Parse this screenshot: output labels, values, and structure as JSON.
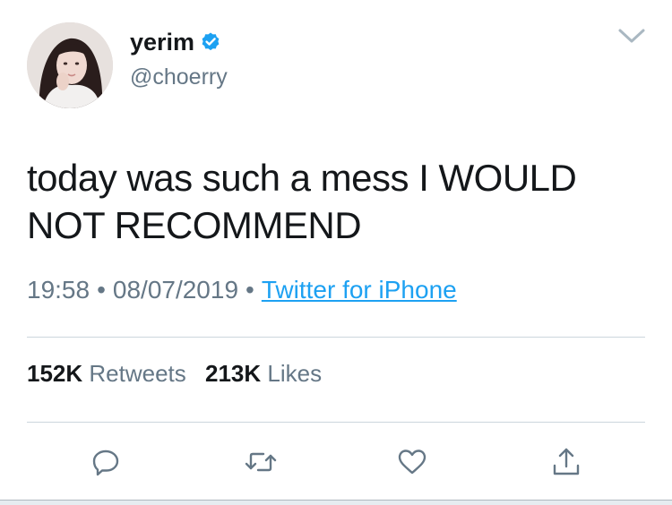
{
  "user": {
    "display_name": "yerim",
    "handle": "@choerry",
    "verified": true
  },
  "tweet": {
    "text": "today was such a mess I WOULD NOT RECOMMEND",
    "time": "19:58",
    "date": "08/07/2019",
    "source": "Twitter for iPhone"
  },
  "stats": {
    "retweets_count": "152K",
    "retweets_label": "Retweets",
    "likes_count": "213K",
    "likes_label": "Likes"
  },
  "icons": {
    "menu": "chevron-down-icon",
    "verified": "verified-badge-icon",
    "reply": "reply-icon",
    "retweet": "retweet-icon",
    "like": "heart-icon",
    "share": "share-icon"
  },
  "colors": {
    "link": "#1da1f2",
    "secondary_text": "#657786",
    "primary_text": "#14171a"
  }
}
